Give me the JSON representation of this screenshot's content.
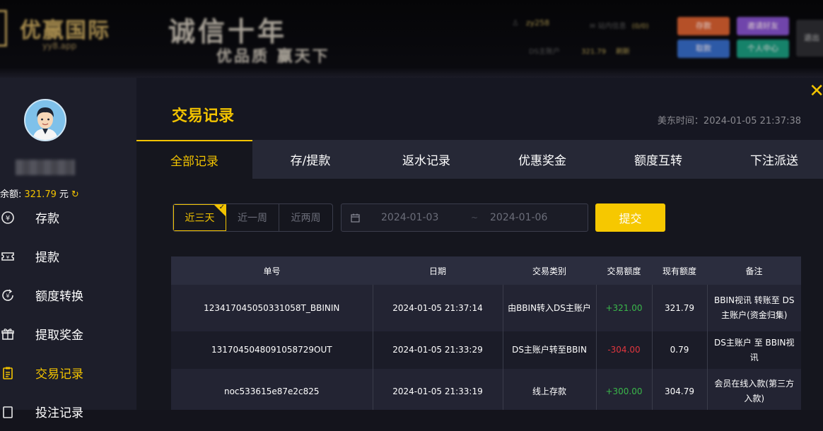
{
  "header": {
    "logo_text": "优赢国际",
    "logo_sub": "yy8.app",
    "slogan_line1": "诚信十年",
    "slogan_line2": "优品质 赢天下",
    "username": "zy258",
    "messages_label": "站内信息",
    "messages_count": "(0/0)",
    "balance_label": "DS主账户",
    "balance_value": "321.79",
    "refresh_label": "刷新",
    "btn_deposit": "存款",
    "btn_invite": "邀请好友",
    "btn_withdraw": "取款",
    "btn_profile": "个人中心",
    "btn_logout": "退出"
  },
  "sidebar": {
    "balance_label": "余额:",
    "balance_amount": "321.79",
    "balance_unit": "元",
    "items": [
      {
        "label": "存款",
        "icon": "yen-coin-icon"
      },
      {
        "label": "提款",
        "icon": "ticket-icon"
      },
      {
        "label": "额度转换",
        "icon": "exchange-icon"
      },
      {
        "label": "提取奖金",
        "icon": "gift-icon"
      },
      {
        "label": "交易记录",
        "icon": "record-icon",
        "active": true
      },
      {
        "label": "投注记录",
        "icon": "bet-icon"
      }
    ]
  },
  "main": {
    "title": "交易记录",
    "time_label": "美东时间：2024-01-05 21:37:38",
    "tabs": [
      "全部记录",
      "存/提款",
      "返水记录",
      "优惠奖金",
      "额度互转",
      "下注派送"
    ],
    "active_tab": 0
  },
  "filters": {
    "ranges": [
      "近三天",
      "近一周",
      "近两周"
    ],
    "active_range": 0,
    "date_start": "2024-01-03",
    "date_sep": "~",
    "date_end": "2024-01-06",
    "submit_label": "提交"
  },
  "table": {
    "columns": [
      "单号",
      "日期",
      "交易类别",
      "交易额度",
      "现有额度",
      "备注"
    ],
    "rows": [
      {
        "id": "123417045050331058T_BBININ",
        "date": "2024-01-05 21:37:14",
        "type": "由BBIN转入DS主账户",
        "amount": "+321.00",
        "amount_sign": "pos",
        "balance": "321.79",
        "note": "BBIN视讯 转账至 DS主账户(资金归集)"
      },
      {
        "id": "1317045048091058729OUT",
        "date": "2024-01-05 21:33:29",
        "type": "DS主账户转至BBIN",
        "amount": "-304.00",
        "amount_sign": "neg",
        "balance": "0.79",
        "note": "DS主账户 至 BBIN视讯"
      },
      {
        "id": "noc533615e87e2c825",
        "date": "2024-01-05 21:33:19",
        "type": "线上存款",
        "amount": "+300.00",
        "amount_sign": "pos",
        "balance": "304.79",
        "note": "会员在线入款(第三方入款)"
      }
    ]
  }
}
